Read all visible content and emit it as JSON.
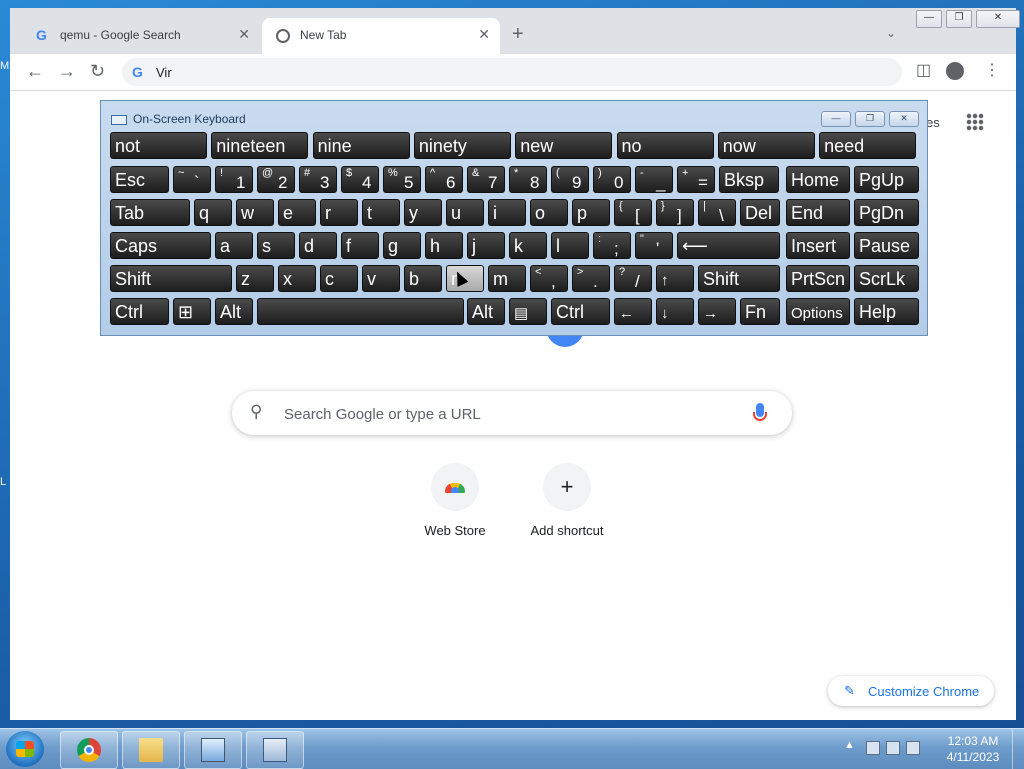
{
  "desktop": {
    "left_letter_top": "M",
    "left_letter_mid": "L"
  },
  "browser": {
    "tabs": [
      {
        "title": "qemu - Google Search",
        "favicon": "google-g-icon"
      },
      {
        "title": "New Tab",
        "favicon": "chrome-icon"
      }
    ],
    "new_tab_symbol": "+",
    "tab_search_symbol": "⌄",
    "address_value": "Vir",
    "window_controls": {
      "minimize": "—",
      "restore": "❐",
      "close": "✕"
    }
  },
  "newtab": {
    "top_right_partial": "es",
    "search_placeholder": "Search Google or type a URL",
    "shortcuts": [
      {
        "label": "Web Store",
        "icon": "web-store-icon"
      },
      {
        "label": "Add shortcut",
        "icon": "plus-icon",
        "symbol": "+"
      }
    ],
    "customize_label": "Customize Chrome"
  },
  "osk": {
    "title": "On-Screen Keyboard",
    "predictions": [
      "not",
      "nineteen",
      "nine",
      "ninety",
      "new",
      "no",
      "now",
      "need"
    ],
    "keys": {
      "esc": "Esc",
      "digits": [
        {
          "shift": "~",
          "base": "`"
        },
        {
          "shift": "!",
          "base": "1"
        },
        {
          "shift": "@",
          "base": "2"
        },
        {
          "shift": "#",
          "base": "3"
        },
        {
          "shift": "$",
          "base": "4"
        },
        {
          "shift": "%",
          "base": "5"
        },
        {
          "shift": "^",
          "base": "6"
        },
        {
          "shift": "&",
          "base": "7"
        },
        {
          "shift": "*",
          "base": "8"
        },
        {
          "shift": "(",
          "base": "9"
        },
        {
          "shift": ")",
          "base": "0"
        },
        {
          "shift": "-",
          "base": "_"
        },
        {
          "shift": "+",
          "base": "="
        }
      ],
      "bksp": "Bksp",
      "home": "Home",
      "pgup": "PgUp",
      "tab": "Tab",
      "row_q": [
        "q",
        "w",
        "e",
        "r",
        "t",
        "y",
        "u",
        "i",
        "o",
        "p"
      ],
      "brackets": [
        {
          "shift": "{",
          "base": "["
        },
        {
          "shift": "}",
          "base": "]"
        },
        {
          "shift": "|",
          "base": "\\"
        }
      ],
      "del": "Del",
      "end": "End",
      "pgdn": "PgDn",
      "caps": "Caps",
      "row_a": [
        "a",
        "s",
        "d",
        "f",
        "g",
        "h",
        "j",
        "k",
        "l"
      ],
      "semi": [
        {
          "shift": ":",
          "base": ";"
        },
        {
          "shift": "\"",
          "base": "'"
        }
      ],
      "enter": "⟵",
      "insert": "Insert",
      "pause": "Pause",
      "shift": "Shift",
      "row_z": [
        "z",
        "x",
        "c",
        "v",
        "b",
        "n",
        "m"
      ],
      "punct": [
        {
          "shift": "<",
          "base": ","
        },
        {
          "shift": ">",
          "base": "."
        },
        {
          "shift": "?",
          "base": "/"
        }
      ],
      "up": "↑",
      "prtscn": "PrtScn",
      "scrlk": "ScrLk",
      "ctrl": "Ctrl",
      "win": "⊞",
      "alt": "Alt",
      "menu": "▤",
      "left": "←",
      "down": "↓",
      "right": "→",
      "fn": "Fn",
      "options": "Options",
      "help": "Help"
    },
    "window_controls": {
      "minimize": "—",
      "restore": "❐",
      "close": "✕"
    }
  },
  "taskbar": {
    "items": [
      "start-button",
      "chrome",
      "windows-explorer",
      "control-panel",
      "on-screen-keyboard"
    ],
    "tray_arrow": "▲",
    "time": "12:03 AM",
    "date": "4/11/2023"
  }
}
